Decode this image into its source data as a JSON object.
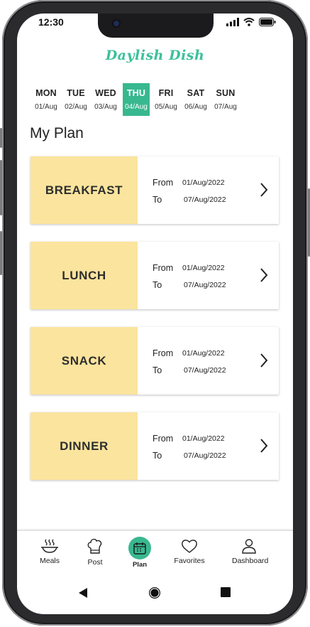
{
  "status_bar": {
    "time": "12:30",
    "icons": [
      "signal-icon",
      "wifi-icon",
      "battery-icon"
    ]
  },
  "app": {
    "logo": "Daylish Dish"
  },
  "week": {
    "days": [
      {
        "name": "MON",
        "date": "01/Aug",
        "active": false
      },
      {
        "name": "TUE",
        "date": "02/Aug",
        "active": false
      },
      {
        "name": "WED",
        "date": "03/Aug",
        "active": false
      },
      {
        "name": "THU",
        "date": "04/Aug",
        "active": true
      },
      {
        "name": "FRI",
        "date": "05/Aug",
        "active": false
      },
      {
        "name": "SAT",
        "date": "06/Aug",
        "active": false
      },
      {
        "name": "SUN",
        "date": "07/Aug",
        "active": false
      }
    ]
  },
  "page": {
    "title": "My Plan"
  },
  "plans": [
    {
      "meal": "BREAKFAST",
      "from_label": "From",
      "from": "01/Aug/2022",
      "to_label": "To",
      "to": "07/Aug/2022"
    },
    {
      "meal": "LUNCH",
      "from_label": "From",
      "from": "01/Aug/2022",
      "to_label": "To",
      "to": "07/Aug/2022"
    },
    {
      "meal": "SNACK",
      "from_label": "From",
      "from": "01/Aug/2022",
      "to_label": "To",
      "to": "07/Aug/2022"
    },
    {
      "meal": "DINNER",
      "from_label": "From",
      "from": "01/Aug/2022",
      "to_label": "To",
      "to": "07/Aug/2022"
    }
  ],
  "nav": {
    "items": [
      {
        "label": "Meals",
        "icon": "meal-bowl-icon",
        "active": false
      },
      {
        "label": "Post",
        "icon": "chef-hat-icon",
        "active": false
      },
      {
        "label": "Plan",
        "icon": "calendar-icon",
        "active": true
      },
      {
        "label": "Favorites",
        "icon": "heart-icon",
        "active": false
      },
      {
        "label": "Dashboard",
        "icon": "user-icon",
        "active": false
      }
    ]
  },
  "system_nav": {
    "icons": [
      "back-icon",
      "home-icon",
      "recents-icon"
    ]
  },
  "colors": {
    "accent": "#38b88f",
    "meal_tile": "#fbe49d",
    "logo": "#3cc09a"
  }
}
